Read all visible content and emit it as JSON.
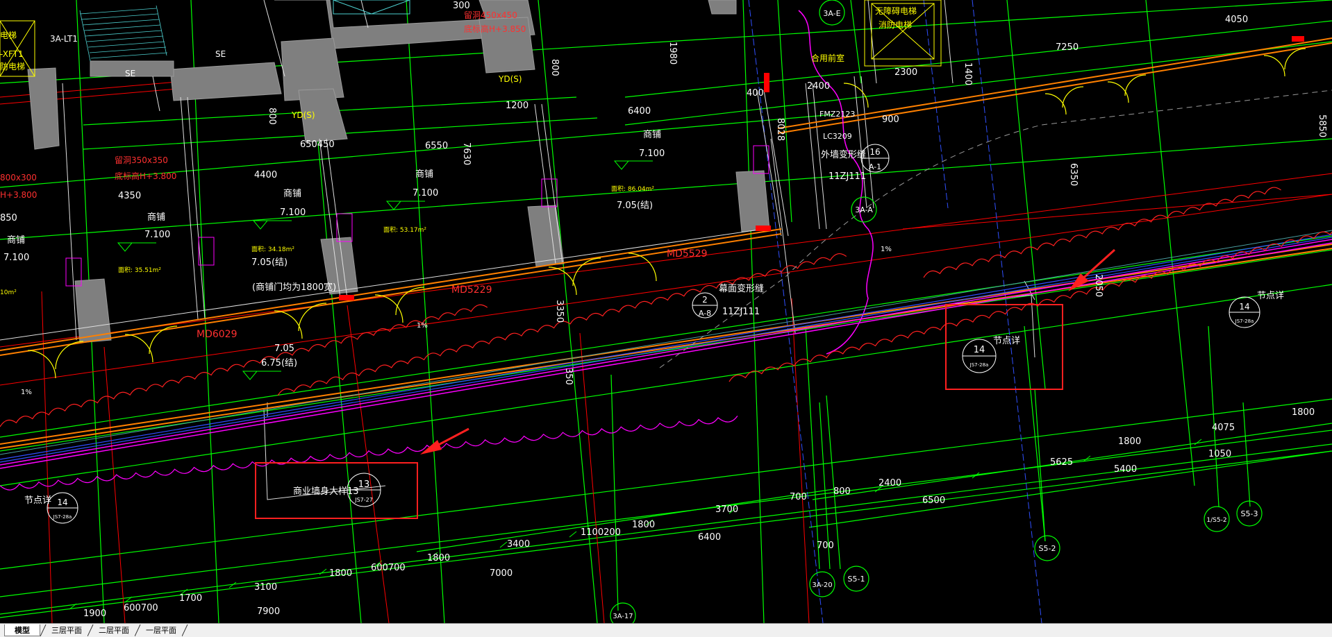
{
  "layout_tabs": [
    {
      "label": "模型",
      "active": true
    },
    {
      "label": "三层平面",
      "active": false
    },
    {
      "label": "二层平面",
      "active": false
    },
    {
      "label": "一层平面",
      "active": false
    }
  ],
  "colors": {
    "background": "#000000",
    "axis_green": "#00ff00",
    "axis_red": "#ff0000",
    "wall_gray": "#808080",
    "text_white": "#ffffff",
    "text_yellow": "#ffff00",
    "highlight_box": "#ff2020",
    "arrow": "#ff2020",
    "magenta_line": "#ff00ff",
    "orange_line": "#ff8000",
    "blue_line": "#3050ff"
  },
  "labels": {
    "shop": "商铺",
    "node_detail": "节点详",
    "commercial_wall_sample": "商业墙身大样13",
    "curtain_wall_joint": "幕面变形缝",
    "exterior_wall_joint": "外墙变形缝",
    "public_toilet": "合用前室",
    "accessible_elevator": "无障碍电梯",
    "fire_elevator": "消防电梯",
    "shop_door_note": "(商铺门均为1800宽)",
    "beam_450": "留洞450x450",
    "beam_450_elev": "底标高H+3.850",
    "beam_350": "留洞350x350",
    "beam_350_elev": "底标高H+3.800",
    "beam_300": "800x300",
    "beam_300_elev": "H+3.800",
    "lt1": "3A-LT1",
    "xf": "-XFT1",
    "xf2": "电梯",
    "xf3": "防电梯",
    "se": "SE"
  },
  "tags": {
    "yd": "YD(S)",
    "md6029": "MD6029",
    "md5229": "MD5229",
    "md5529": "MD5529",
    "fmz": "FMZ2123",
    "lc": "LC3209",
    "ref_11zj": "11ZJ111",
    "ref_11zj_b": "11ZJ111"
  },
  "elevations": {
    "e7100": "7.100",
    "e705": "7.05",
    "e705j": "7.05(结)",
    "e675j": "6.75(结)",
    "slope": "1%"
  },
  "areas": {
    "a1": "面积: 35.51m²",
    "a2": "面积: 34.18m²",
    "a3": "面积: 53.17m²",
    "a4": "面积: 86.04m²",
    "a5": "10m²"
  },
  "bubbles": {
    "b14_top": "14",
    "b14_bot": "JS7-28a",
    "b13_top": "13",
    "b13_bot": "JS7-27",
    "b2_top": "2",
    "b2_bot": "A-8",
    "b16_top": "16",
    "b16_bot": "A-1",
    "axis_3a_e": "3A-E",
    "axis_3a_a": "3A-A",
    "axis_3a_20": "3A-20",
    "axis_s5_1": "S5-1",
    "axis_s5_2": "S5-2",
    "axis_s5_3": "S5-3",
    "axis_1s5_2": "1/S5-2",
    "axis_3a_17": "3A-17"
  },
  "dims": {
    "d1": "1980",
    "d2": "4050",
    "d3": "7250",
    "d4": "2400",
    "d5": "2300",
    "d6": "900",
    "d7": "1400",
    "d8": "6400",
    "d9": "6550",
    "d10": "7630",
    "d11": "1200",
    "d12": "800",
    "d13": "4400",
    "d14": "4350",
    "d15": "650450",
    "d16": "6350",
    "d17": "5850",
    "d18": "400",
    "d19": "3350",
    "d20": "350",
    "d21": "2050",
    "d22": "1800",
    "d23": "4075",
    "d24": "5625",
    "d25": "5400",
    "d26": "1050",
    "d27": "700",
    "d28": "800",
    "d29": "2400",
    "d30": "6500",
    "d31": "3700",
    "d32": "1800",
    "d33": "1100200",
    "d34": "6400",
    "d35": "3400",
    "d36": "7000",
    "d37": "1800",
    "d38": "600700",
    "d39": "1800",
    "d40": "3100",
    "d41": "1700",
    "d42": "600700",
    "d43": "1900",
    "d44": "7900",
    "d45": "700",
    "d46": "300",
    "d47": "850",
    "d48": "8028",
    "d49": "1800"
  }
}
